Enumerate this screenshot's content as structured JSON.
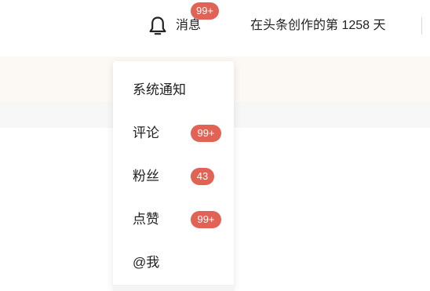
{
  "header": {
    "notifications_label": "消息",
    "notifications_badge": "99+",
    "creator_days_text": "在头条创作的第 1258 天",
    "bell_icon": "bell-icon"
  },
  "notifications_menu": {
    "items": [
      {
        "label": "系统通知",
        "badge": ""
      },
      {
        "label": "评论",
        "badge": "99+"
      },
      {
        "label": "粉丝",
        "badge": "43"
      },
      {
        "label": "点赞",
        "badge": "99+"
      },
      {
        "label": "@我",
        "badge": ""
      }
    ]
  },
  "colors": {
    "badge": "#e06355",
    "banner": "#fcf8f3",
    "band": "#f7f7f7"
  }
}
